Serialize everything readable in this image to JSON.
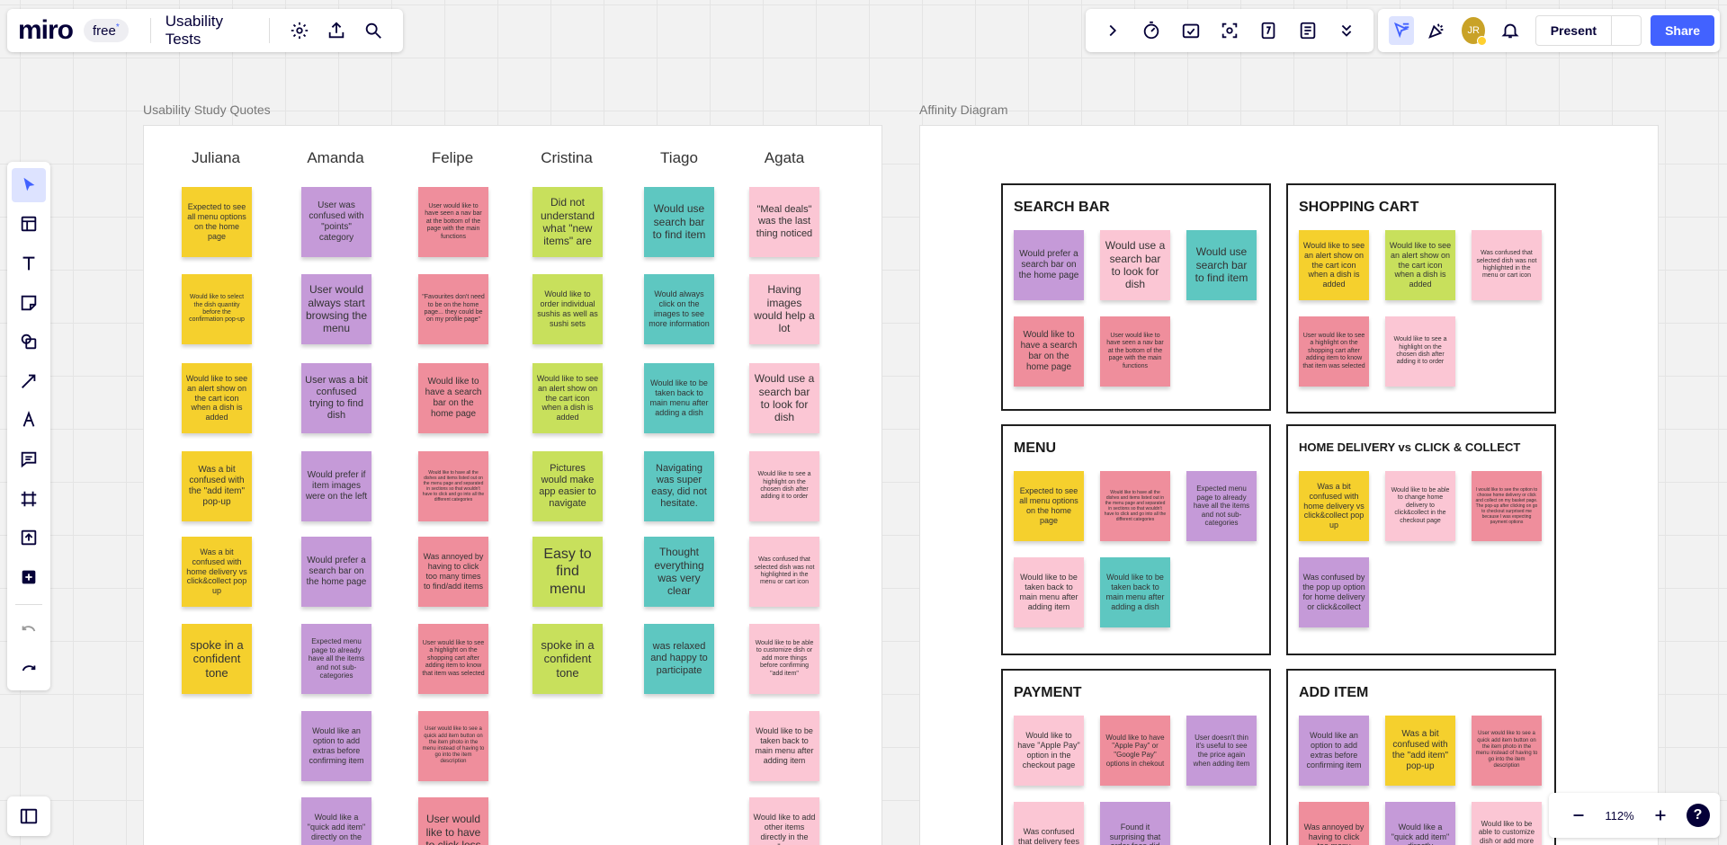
{
  "app": {
    "logo": "miro",
    "plan": "free",
    "plan_mark": "*",
    "board_title": "Usability Tests"
  },
  "topbar_right": {
    "present_label": "Present",
    "share_label": "Share",
    "avatar_initials": "JR"
  },
  "zoom": {
    "level": "112%",
    "help": "?"
  },
  "frames": {
    "quotes_label": "Usability Study Quotes",
    "affinity_label": "Affinity Diagram"
  },
  "colors": {
    "yellow": "#f5d02d",
    "purple": "#c59ad8",
    "red": "#ef8e9c",
    "green": "#c8e05c",
    "teal": "#5ec7c1",
    "pink": "#fbc6d4",
    "accent": "#4262ff"
  },
  "quotes": {
    "headers": [
      "Juliana",
      "Amanda",
      "Felipe",
      "Cristina",
      "Tiago",
      "Agata"
    ],
    "columns": [
      [
        {
          "text": "Expected to see all menu options on the home page",
          "color": "yellow",
          "fs": 9
        },
        {
          "text": "Would like to select the dish quantity before the confirmation pop-up",
          "color": "yellow",
          "fs": 7
        },
        {
          "text": "Would like to see an alert show on the cart icon when a dish is added",
          "color": "yellow",
          "fs": 9
        },
        {
          "text": "Was a bit confused with the \"add item\" pop-up",
          "color": "yellow",
          "fs": 10
        },
        {
          "text": "Was a bit confused with home delivery vs click&collect pop up",
          "color": "yellow",
          "fs": 9
        },
        {
          "text": "spoke in a confident tone",
          "color": "yellow",
          "fs": 13
        }
      ],
      [
        {
          "text": "User was confused with \"points\" category",
          "color": "purple",
          "fs": 10
        },
        {
          "text": "User would always start browsing the menu",
          "color": "purple",
          "fs": 12
        },
        {
          "text": "User was a bit confused trying to find dish",
          "color": "purple",
          "fs": 11
        },
        {
          "text": "Would prefer if item images were on the left",
          "color": "purple",
          "fs": 10
        },
        {
          "text": "Would prefer a search bar on the home page",
          "color": "purple",
          "fs": 10
        },
        {
          "text": "Expected menu page to already have all the items and not sub-categories",
          "color": "purple",
          "fs": 8
        },
        {
          "text": "Would like an option to add extras before confirming item",
          "color": "purple",
          "fs": 9
        },
        {
          "text": "Would like a \"quick add item\" directly on the menu",
          "color": "purple",
          "fs": 9
        }
      ],
      [
        {
          "text": "User would like to have seen a nav bar at the bottom of the page with the main functions",
          "color": "red",
          "fs": 7
        },
        {
          "text": "\"Favourites don't need to be on the home page... they could be on my profile page\"",
          "color": "red",
          "fs": 7
        },
        {
          "text": "Would like to have a search bar on the home page",
          "color": "red",
          "fs": 10
        },
        {
          "text": "Would like to have all the dishes and items listed out on the menu page and separated in sections so that wouldn't have to click and go into all the different categories",
          "color": "red",
          "fs": 5
        },
        {
          "text": "Was annoyed by having to click too many times to find/add items",
          "color": "red",
          "fs": 9
        },
        {
          "text": "User would like to see a highlight on the shopping cart after adding item to know that item was selected",
          "color": "red",
          "fs": 7
        },
        {
          "text": "User would like to see a quick add item button on the item photo in the menu instead of having to go into the item description",
          "color": "red",
          "fs": 6
        },
        {
          "text": "User would like to have to click less",
          "color": "red",
          "fs": 12
        }
      ],
      [
        {
          "text": "Did not understand what \"new items\" are",
          "color": "green",
          "fs": 12
        },
        {
          "text": "Would like to order individual sushis as well as sushi sets",
          "color": "green",
          "fs": 9
        },
        {
          "text": "Would like to see an alert show on the cart icon when a dish is added",
          "color": "green",
          "fs": 9
        },
        {
          "text": "Pictures would make app easier to navigate",
          "color": "green",
          "fs": 11
        },
        {
          "text": "Easy to find menu",
          "color": "green",
          "fs": 16
        },
        {
          "text": "spoke in a confident tone",
          "color": "green",
          "fs": 13
        }
      ],
      [
        {
          "text": "Would use search bar to find item",
          "color": "teal",
          "fs": 12
        },
        {
          "text": "Would always click on the images to see more information",
          "color": "teal",
          "fs": 9
        },
        {
          "text": "Would like to be taken back to main menu after adding a dish",
          "color": "teal",
          "fs": 9
        },
        {
          "text": "Navigating was super easy, did not hesitate.",
          "color": "teal",
          "fs": 11
        },
        {
          "text": "Thought everything was very clear",
          "color": "teal",
          "fs": 12
        },
        {
          "text": "was relaxed and happy to participate",
          "color": "teal",
          "fs": 11
        }
      ],
      [
        {
          "text": "\"Meal deals\" was the last thing noticed",
          "color": "pink",
          "fs": 11
        },
        {
          "text": "Having images would help a lot",
          "color": "pink",
          "fs": 12
        },
        {
          "text": "Would use a search bar to look for dish",
          "color": "pink",
          "fs": 12
        },
        {
          "text": "Would like to see a highlight on the chosen dish after adding it to order",
          "color": "pink",
          "fs": 7
        },
        {
          "text": "Was confused that selected dish was not highlighted in the menu or cart icon",
          "color": "pink",
          "fs": 7
        },
        {
          "text": "Would like to be able to customize dish or add more things before confirming \"add item\"",
          "color": "pink",
          "fs": 7
        },
        {
          "text": "Would like to be taken back to main menu after adding item",
          "color": "pink",
          "fs": 9
        },
        {
          "text": "Would like to add other items directly in the \"my",
          "color": "pink",
          "fs": 9
        }
      ]
    ]
  },
  "affinity": [
    {
      "title": "SEARCH BAR",
      "notes": [
        {
          "text": "Would prefer a search bar on the home page",
          "color": "purple",
          "fs": 10
        },
        {
          "text": "Would use a search bar to look for dish",
          "color": "pink",
          "fs": 12
        },
        {
          "text": "Would use search bar to find item",
          "color": "teal",
          "fs": 12
        },
        {
          "text": "Would like to have a search bar on the home page",
          "color": "red",
          "fs": 10
        },
        {
          "text": "User would like to have seen a nav bar at the bottom of the page with the main functions",
          "color": "red",
          "fs": 7
        }
      ]
    },
    {
      "title": "SHOPPING CART",
      "notes": [
        {
          "text": "Would like to see an alert show on the cart icon when a dish is added",
          "color": "yellow",
          "fs": 9
        },
        {
          "text": "Would like to see an alert show on the cart icon when a dish is added",
          "color": "green",
          "fs": 9
        },
        {
          "text": "Was confused that selected dish was not highlighted in the menu or cart icon",
          "color": "pink",
          "fs": 7
        },
        {
          "text": "User would like to see a highlight on the shopping cart after adding item to know that item was selected",
          "color": "red",
          "fs": 7
        },
        {
          "text": "Would like to see a highlight on the chosen dish after adding it to order",
          "color": "pink",
          "fs": 7
        }
      ]
    },
    {
      "title": "MENU",
      "notes": [
        {
          "text": "Expected to see all menu options on the home page",
          "color": "yellow",
          "fs": 9
        },
        {
          "text": "Would like to have all the dishes and items listed out in the menu page and separated in sections so that wouldn't have to click and go into all the different categories",
          "color": "red",
          "fs": 5
        },
        {
          "text": "Expected menu page to already have all the items and not sub-categories",
          "color": "purple",
          "fs": 8
        },
        {
          "text": "Would like to be taken back to main menu after adding item",
          "color": "pink",
          "fs": 9
        },
        {
          "text": "Would like to be taken back to main menu after adding a dish",
          "color": "teal",
          "fs": 9
        }
      ]
    },
    {
      "title": "HOME DELIVERY vs CLICK & COLLECT",
      "small": true,
      "notes": [
        {
          "text": "Was a bit confused with home delivery vs click&collect pop up",
          "color": "yellow",
          "fs": 9
        },
        {
          "text": "Would like to be able to change home delivery to click&collect in the checkout page",
          "color": "pink",
          "fs": 7
        },
        {
          "text": "I would like to see the option to choose home delivery or click and collect on my basket page. The pop-up after clicking on go to checkout surprised me because I was expecting payment options",
          "color": "red",
          "fs": 5
        },
        {
          "text": "Was confused by the pop up option for home delivery or click&collect",
          "color": "purple",
          "fs": 9
        }
      ]
    },
    {
      "title": "PAYMENT",
      "notes": [
        {
          "text": "Would like to have \"Apple Pay\" option in the checkout page",
          "color": "pink",
          "fs": 9
        },
        {
          "text": "Would like to have \"Apple Pay\" or \"Google Pay\" options in chekout",
          "color": "red",
          "fs": 8
        },
        {
          "text": "User doesn't thin it's useful to see the price again when adding item",
          "color": "purple",
          "fs": 8
        },
        {
          "text": "Was confused that delivery fees",
          "color": "pink",
          "fs": 9
        },
        {
          "text": "Found it surprising that order fees did",
          "color": "purple",
          "fs": 9
        }
      ]
    },
    {
      "title": "ADD ITEM",
      "notes": [
        {
          "text": "Would like an option to add extras before confirming item",
          "color": "purple",
          "fs": 9
        },
        {
          "text": "Was a bit confused with the \"add item\" pop-up",
          "color": "yellow",
          "fs": 10
        },
        {
          "text": "User would like to see a quick add item button on the item photo in the menu instead of having to go into the item description",
          "color": "red",
          "fs": 6
        },
        {
          "text": "Was annoyed by having to click too many",
          "color": "red",
          "fs": 9
        },
        {
          "text": "Would like a \"quick add item\" directly",
          "color": "purple",
          "fs": 9
        },
        {
          "text": "Would like to be able to customize dish or add more things before",
          "color": "pink",
          "fs": 8
        }
      ]
    }
  ]
}
